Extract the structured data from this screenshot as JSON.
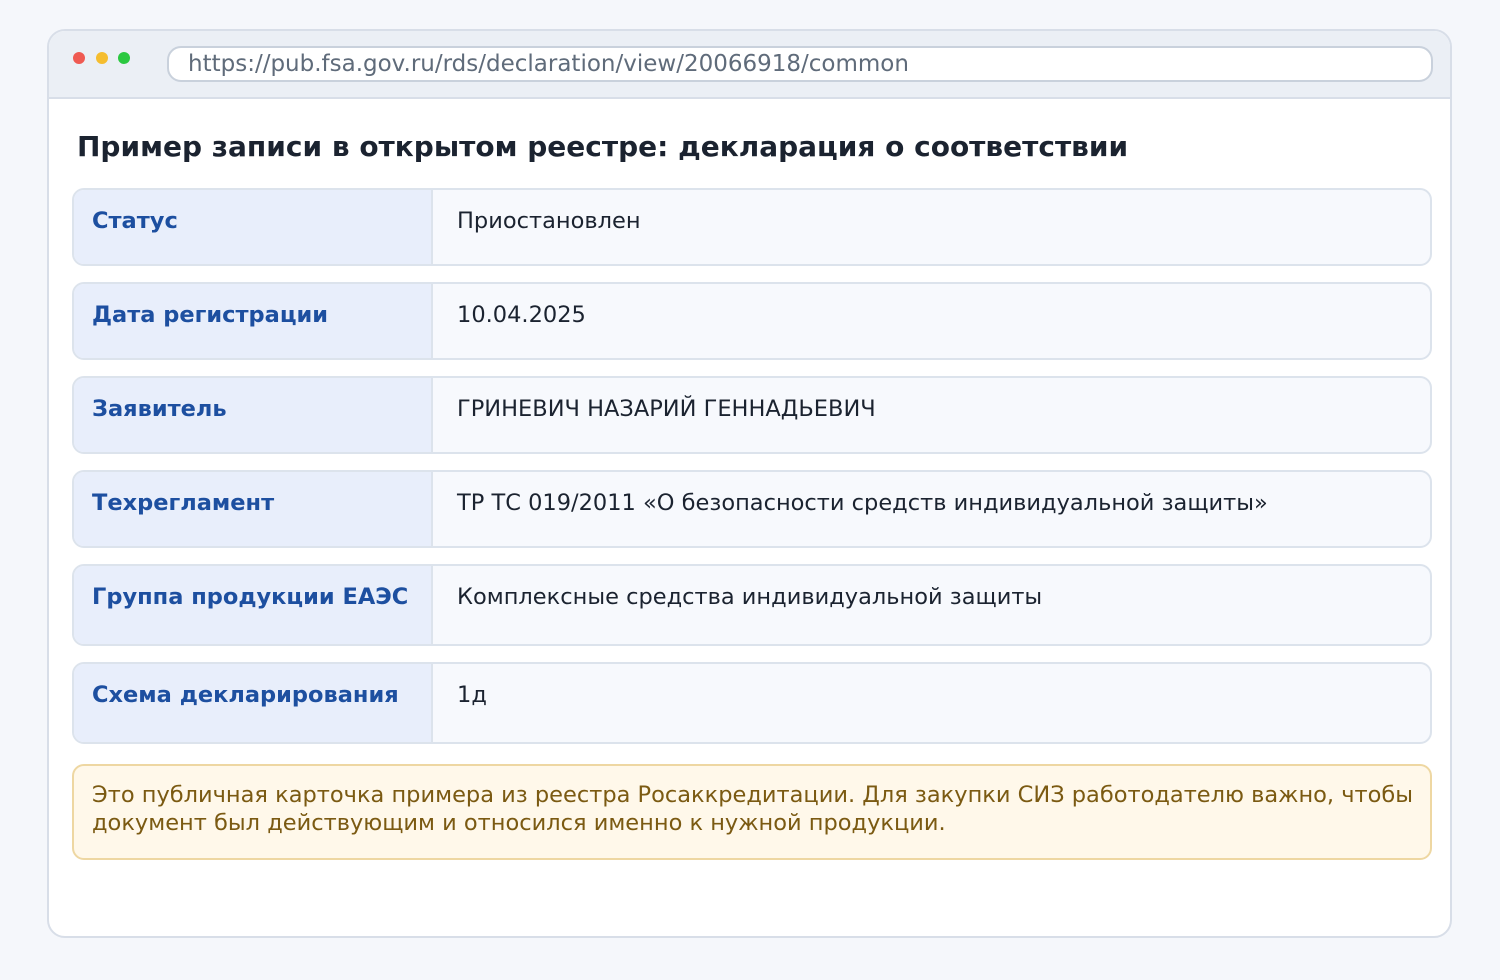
{
  "browser": {
    "url": "https://pub.fsa.gov.ru/rds/declaration/view/20066918/common"
  },
  "page": {
    "title": "Пример записи в открытом реестре: декларация о соответствии"
  },
  "fields": [
    {
      "label": "Статус",
      "value": "Приостановлен"
    },
    {
      "label": "Дата регистрации",
      "value": "10.04.2025"
    },
    {
      "label": "Заявитель",
      "value": "ГРИНЕВИЧ НАЗАРИЙ ГЕННАДЬЕВИЧ"
    },
    {
      "label": "Техрегламент",
      "value": "ТР ТС 019/2011 «О безопасности средств индивидуальной защиты»"
    },
    {
      "label": "Группа продукции ЕАЭС",
      "value": "Комплексные средства индивидуальной защиты"
    },
    {
      "label": "Схема декларирования",
      "value": "1д"
    }
  ],
  "note": {
    "text": "Это публичная карточка примера из реестра Росаккредитации. Для закупки СИЗ работодателю важно, чтобы документ был действующим и относился именно к нужной продукции."
  },
  "colors": {
    "page_background": "#f5f7fb",
    "label_text": "#1d4fa0",
    "label_background": "#e8eefb",
    "note_background": "#fff8ea",
    "note_text": "#7b5a12"
  }
}
